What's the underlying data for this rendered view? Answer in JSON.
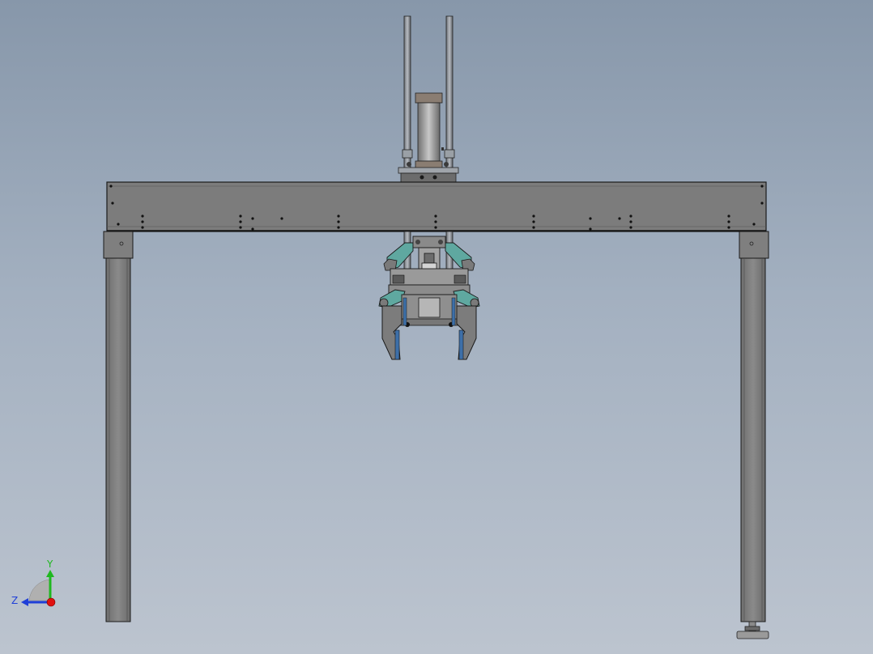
{
  "viewport": {
    "background_top": "#8797aa",
    "background_bottom": "#bcc4cf"
  },
  "model": {
    "frame_color": "#7a7a7a",
    "edge_color": "#1a1a1a",
    "clamp_accent_color": "#5fa8a0",
    "jaw_pad_color": "#3d6fa8"
  },
  "triad": {
    "y_label": "Y",
    "z_label": "Z",
    "y_color": "#1fb81f",
    "z_color": "#1f3fd8",
    "x_color": "#e01010"
  }
}
